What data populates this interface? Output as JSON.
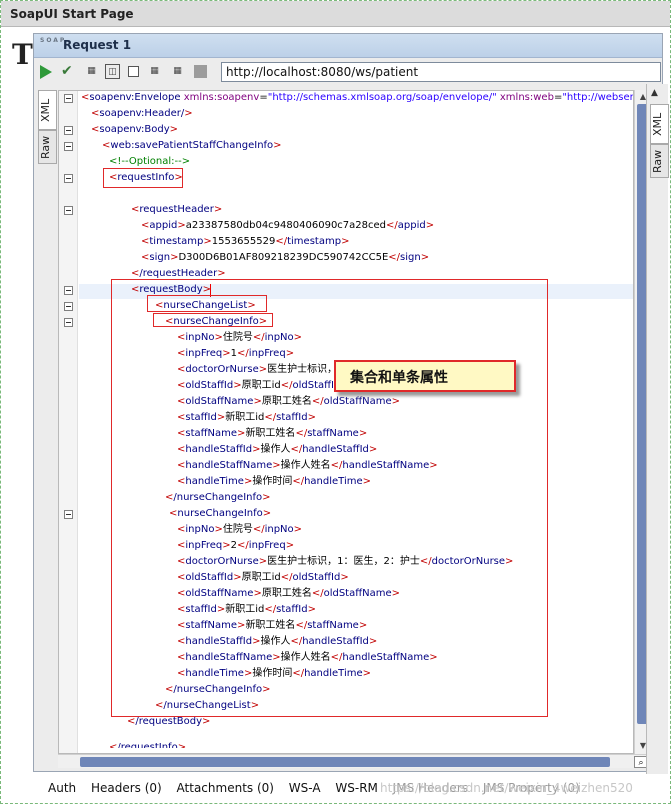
{
  "app": {
    "start_tab_title": "SoapUI Start Page",
    "start_page_heading_letter": "T"
  },
  "request": {
    "window_title": "Request 1",
    "logo_text": "SOAP",
    "endpoint_url": "http://localhost:8080/ws/patient"
  },
  "editor_tabs": {
    "xml": "XML",
    "raw": "Raw"
  },
  "right_panel_tabs": {
    "xml": "XML",
    "raw": "Raw"
  },
  "xml": {
    "envelope_open": "soapenv:Envelope",
    "xmlns_soapenv_attr": "xmlns:soapenv",
    "xmlns_soapenv_val": "\"http://schemas.xmlsoap.org/soap/envelope/\"",
    "xmlns_web_attr": "xmlns:web",
    "xmlns_web_val": "\"http://webservic",
    "header_selfclose": "soapenv:Header/",
    "body_open": "soapenv:Body",
    "method_open": "web:savePatientStaffChangeInfo",
    "optional_comment": "<!--Optional:-->",
    "request_info": "requestInfo",
    "request_header": "requestHeader",
    "appid_tag": "appid",
    "appid_value": "a23387580db04c9480406090c7a28ced",
    "timestamp_tag": "timestamp",
    "timestamp_value": "1553655529",
    "sign_tag": "sign",
    "sign_value": "D300D6B01AF809218239DC590742CC5E",
    "request_header_close": "/requestHeader",
    "request_body": "requestBody",
    "nurse_change_list": "nurseChangeList",
    "nurse_change_info": "nurseChangeInfo",
    "nurse_change_info_close": "/nurseChangeInfo",
    "nurse_change_list_close": "/nurseChangeList",
    "request_body_close": "/requestBody",
    "request_info_close": "/requestInfo",
    "fields": [
      {
        "tag": "inpNo",
        "value": "住院号"
      },
      {
        "tag": "inpFreq",
        "value": "1"
      },
      {
        "tag": "doctorOrNurse",
        "value": "医生护士标识，1：医生，2：护士"
      },
      {
        "tag": "oldStaffId",
        "value": "原职工id"
      },
      {
        "tag": "oldStaffName",
        "value": "原职工姓名"
      },
      {
        "tag": "staffId",
        "value": "新职工id"
      },
      {
        "tag": "staffName",
        "value": "新职工姓名"
      },
      {
        "tag": "handleStaffId",
        "value": "操作人"
      },
      {
        "tag": "handleStaffName",
        "value": "操作人姓名"
      },
      {
        "tag": "handleTime",
        "value": "操作时间"
      }
    ],
    "fields2": [
      {
        "tag": "inpNo",
        "value": "住院号"
      },
      {
        "tag": "inpFreq",
        "value": "2"
      },
      {
        "tag": "doctorOrNurse",
        "value": "医生护士标识，1：医生，2：护士"
      },
      {
        "tag": "oldStaffId",
        "value": "原职工id"
      },
      {
        "tag": "oldStaffName",
        "value": "原职工姓名"
      },
      {
        "tag": "staffId",
        "value": "新职工id"
      },
      {
        "tag": "staffName",
        "value": "新职工姓名"
      },
      {
        "tag": "handleStaffId",
        "value": "操作人"
      },
      {
        "tag": "handleStaffName",
        "value": "操作人姓名"
      },
      {
        "tag": "handleTime",
        "value": "操作时间"
      }
    ]
  },
  "annotation": {
    "callout_text": "集合和单条属性"
  },
  "bottom_tabs": {
    "auth": "Auth",
    "headers": "Headers (0)",
    "attachments": "Attachments (0)",
    "wsa": "WS-A",
    "wsrm": "WS-RM",
    "jms_headers": "JMS Headers",
    "jms_property": "JMS Property (0)"
  },
  "watermark": "https://blog.csdn.net/weixin_4weizhen520"
}
